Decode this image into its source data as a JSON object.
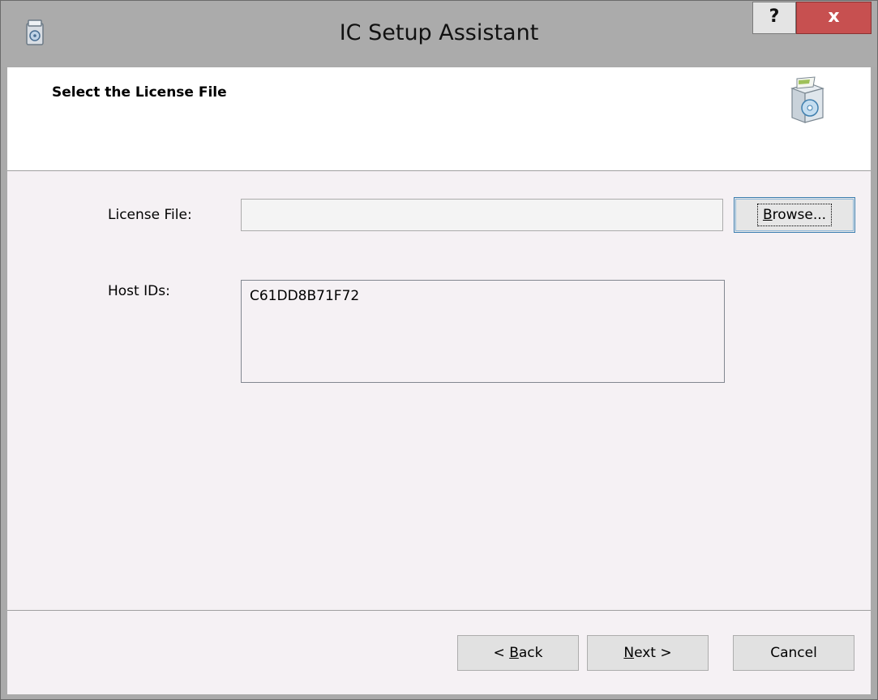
{
  "window": {
    "title": "IC Setup Assistant",
    "help_label": "?",
    "close_label": "x",
    "accent_close_color": "#c75050"
  },
  "header": {
    "title": "Select the License File",
    "icon": "installer-box-icon"
  },
  "form": {
    "license_label": "License File:",
    "license_value": "",
    "browse": {
      "mnemonic": "B",
      "rest": "rowse..."
    },
    "host_label": "Host IDs:",
    "host_ids": "C61DD8B71F72"
  },
  "footer": {
    "back": {
      "prefix": "< ",
      "mnemonic": "B",
      "rest": "ack"
    },
    "next": {
      "mnemonic": "N",
      "rest": "ext >"
    },
    "cancel": "Cancel"
  }
}
